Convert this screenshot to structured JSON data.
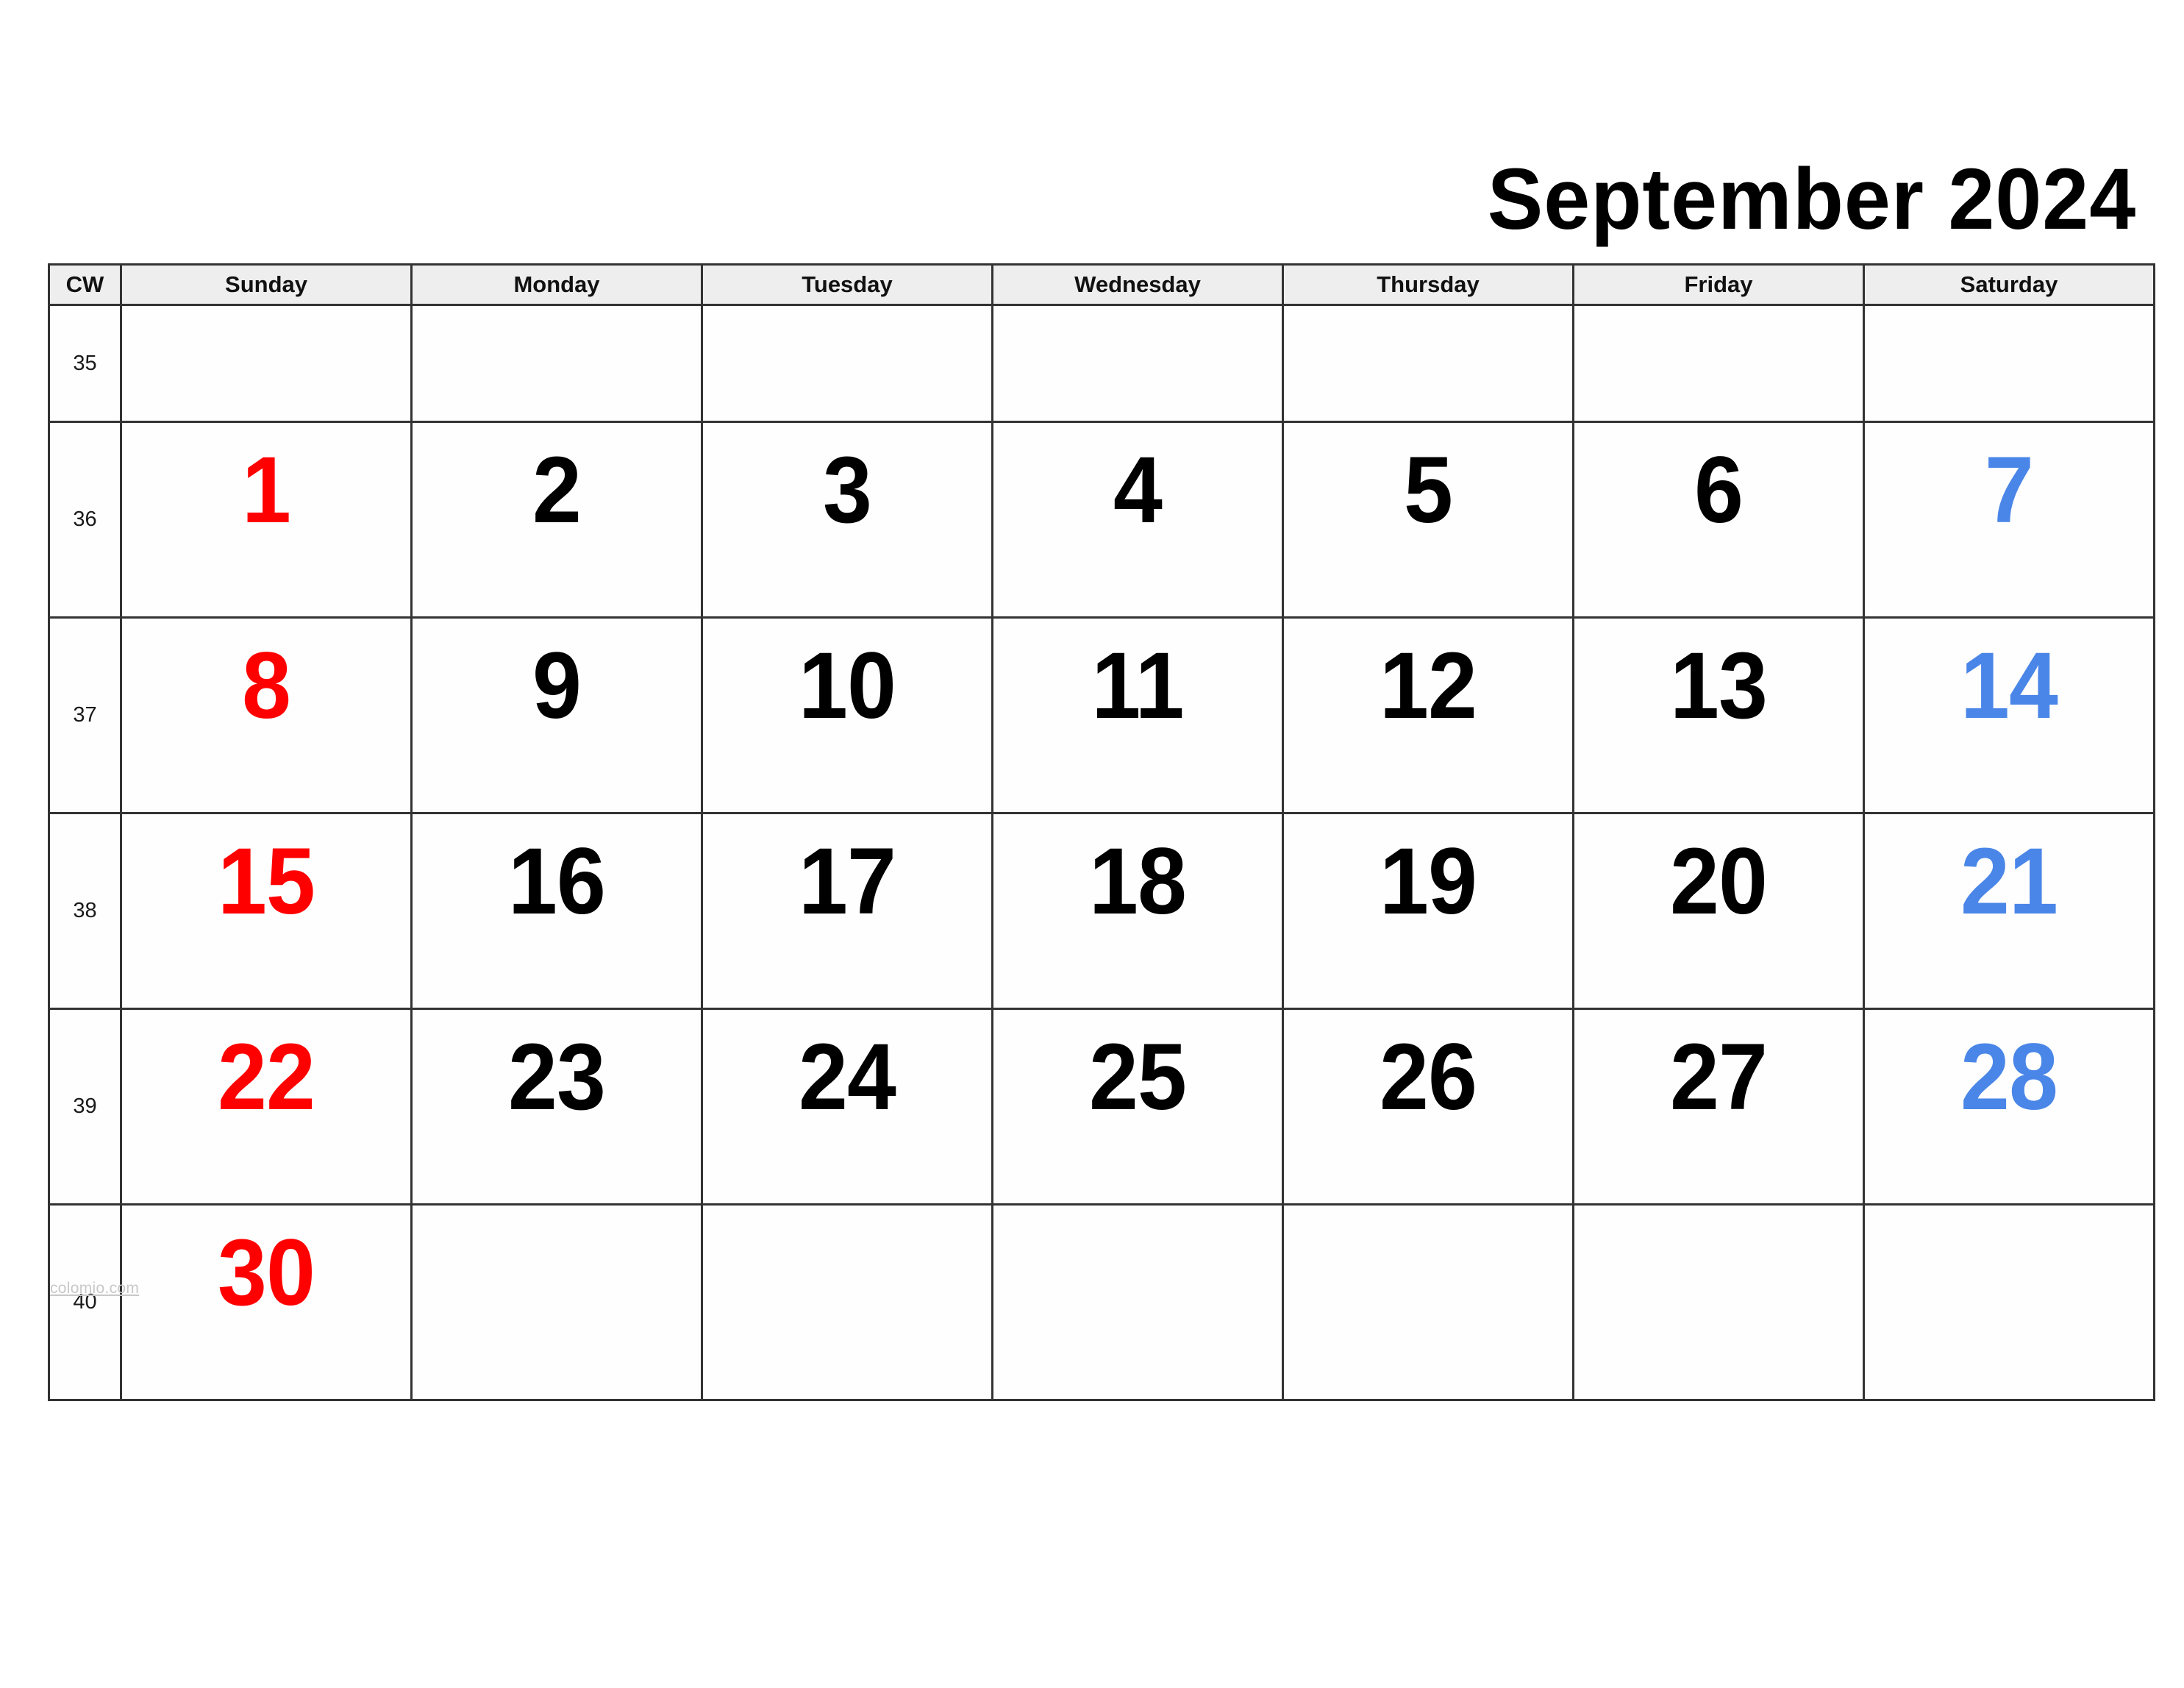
{
  "title": "September 2024",
  "month_name": "September",
  "year": "2024",
  "colors": {
    "sunday": "#ff0000",
    "saturday": "#4a86e8",
    "weekday": "#000000",
    "header_background": "#eeeeee",
    "border": "#333333",
    "page_background": "#ffffff",
    "watermark": "#c8c8c8"
  },
  "header": {
    "cw_label": "CW",
    "days": [
      "Sunday",
      "Monday",
      "Tuesday",
      "Wednesday",
      "Thursday",
      "Friday",
      "Saturday"
    ]
  },
  "weeks": [
    {
      "cw": "35",
      "days": [
        "",
        "",
        "",
        "",
        "",
        "",
        ""
      ]
    },
    {
      "cw": "36",
      "days": [
        "1",
        "2",
        "3",
        "4",
        "5",
        "6",
        "7"
      ]
    },
    {
      "cw": "37",
      "days": [
        "8",
        "9",
        "10",
        "11",
        "12",
        "13",
        "14"
      ]
    },
    {
      "cw": "38",
      "days": [
        "15",
        "16",
        "17",
        "18",
        "19",
        "20",
        "21"
      ]
    },
    {
      "cw": "39",
      "days": [
        "22",
        "23",
        "24",
        "25",
        "26",
        "27",
        "28"
      ]
    },
    {
      "cw": "40",
      "days": [
        "30",
        "",
        "",
        "",
        "",
        "",
        ""
      ]
    }
  ],
  "footer": {
    "watermark": "colomio.com"
  }
}
